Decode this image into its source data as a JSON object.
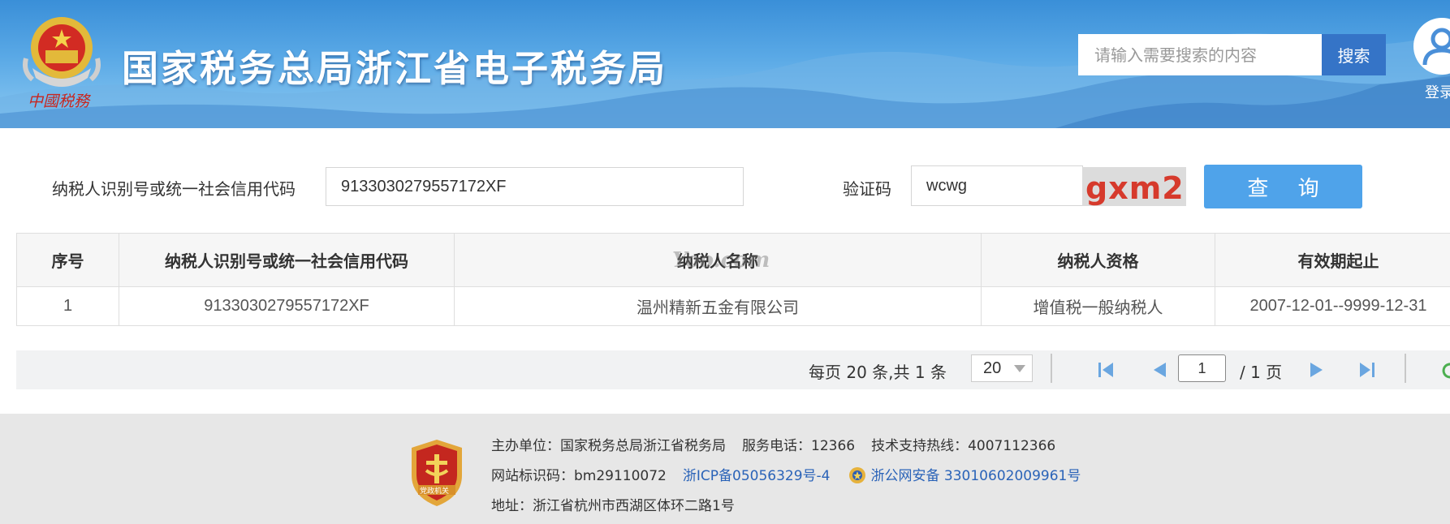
{
  "header": {
    "emblem_caption": "中國税務",
    "site_title": "国家税务总局浙江省电子税务局",
    "search_placeholder": "请输入需要搜索的内容",
    "search_button": "搜索",
    "login_label": "登录"
  },
  "query_form": {
    "taxpayer_id_label": "纳税人识别号或统一社会信用代码",
    "taxpayer_id_value": "9133030279557172XF",
    "captcha_label": "验证码",
    "captcha_value": "wcwg",
    "captcha_image_text": "gxm2",
    "query_button": "查 询"
  },
  "table": {
    "columns": [
      "序号",
      "纳税人识别号或统一社会信用代码",
      "纳税人名称",
      "纳税人资格",
      "有效期起止"
    ],
    "rows": [
      [
        "1",
        "9133030279557172XF",
        "温州精新五金有限公司",
        "增值税一般纳税人",
        "2007-12-01--9999-12-31"
      ]
    ],
    "watermark": "Yoo.com"
  },
  "pagination": {
    "info": "每页 20 条,共 1 条",
    "page_size": "20",
    "current_page": "1",
    "total_pages": "/ 1 页"
  },
  "footer": {
    "badge_text": "党政机关",
    "sponsor": "主办单位：国家税务总局浙江省税务局",
    "service_phone": "服务电话：12366",
    "support_hotline": "技术支持热线：4007112366",
    "site_code": "网站标识码：bm29110072",
    "icp": "浙ICP备05056329号-4",
    "police_record": "浙公网安备 33010602009961号",
    "address": "地址：浙江省杭州市西湖区体环二路1号"
  },
  "colors": {
    "header_blue": "#3a8fd8",
    "search_button": "#3574c7",
    "query_button": "#4fa3ea",
    "captcha_text": "#d63a2c",
    "link_blue": "#2a63b8",
    "footer_bg": "#e7e7e7"
  }
}
